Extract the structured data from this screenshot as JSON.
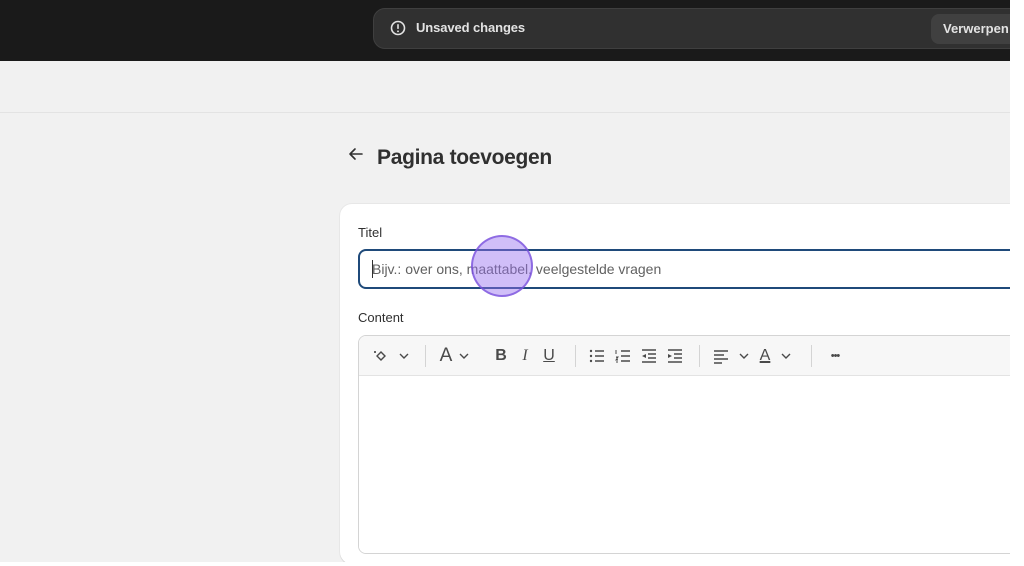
{
  "save_bar": {
    "message": "Unsaved changes",
    "discard_label": "Verwerpen",
    "alert_icon": "alert-circle-icon"
  },
  "page": {
    "back_icon": "arrow-left-icon",
    "title": "Pagina toevoegen"
  },
  "form": {
    "title_label": "Titel",
    "title_placeholder": "Bijv.: over ons, maattabel, veelgestelde vragen",
    "title_value": "",
    "content_label": "Content"
  },
  "toolbar": {
    "items": [
      "magic-icon",
      "chevron-down-icon",
      "text-style-icon",
      "bold-icon",
      "italic-icon",
      "underline-icon",
      "bullet-list-icon",
      "numbered-list-icon",
      "outdent-icon",
      "indent-icon",
      "align-icon",
      "text-color-icon",
      "more-icon"
    ],
    "heading_glyph": "A",
    "bold_glyph": "B",
    "italic_glyph": "I",
    "underline_glyph": "U",
    "color_glyph": "A",
    "more_glyph": "•••"
  },
  "colors": {
    "topbar": "#1a1a1a",
    "save_bar": "#303030",
    "focus_border": "#1f4a7a",
    "click_indicator": "#966ef0"
  }
}
